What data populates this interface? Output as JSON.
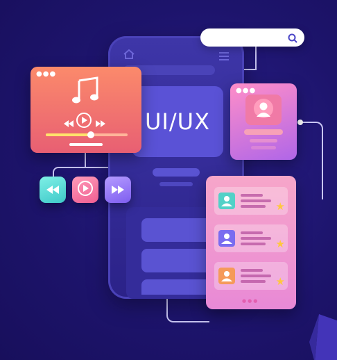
{
  "center_card": {
    "label": "UI/UX"
  },
  "icons": {
    "home": "home-icon",
    "menu": "menu-icon",
    "search": "search-icon",
    "music": "music-note-icon",
    "rewind": "rewind-icon",
    "play": "play-icon",
    "forward": "fast-forward-icon",
    "user": "user-avatar-icon",
    "star": "star-icon"
  },
  "player": {
    "progress": 0.55
  },
  "list_rows": [
    {
      "avatar_color": "#52d1c7",
      "starred": true
    },
    {
      "avatar_color": "#7a6cf0",
      "starred": true
    },
    {
      "avatar_color": "#f59a5a",
      "starred": true
    }
  ],
  "colors": {
    "background": "#1d146c",
    "phone": "#3e36a8",
    "music_card": "#fb8a6b",
    "profile_card": "#c979e0",
    "list_card": "#f0a0d0",
    "rewind_button": "#5ee0d6",
    "play_button": "#ff7aa8",
    "forward_button": "#9a7cf5",
    "star": "#ffc83d"
  }
}
